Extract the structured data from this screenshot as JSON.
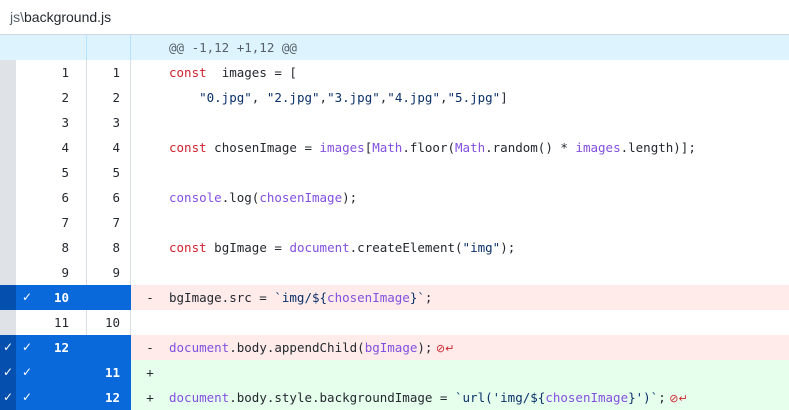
{
  "file": {
    "prefix": "js\\",
    "name": "background.js"
  },
  "hunk": "@@ -1,12 +1,12 @@",
  "lines": [
    {
      "old": "1",
      "new": "1",
      "sign": "",
      "type": "ctx",
      "sel_old": false,
      "sel_new": false,
      "check_gutter": false,
      "code": [
        [
          "kw",
          "const"
        ],
        [
          "",
          "  images = ["
        ]
      ]
    },
    {
      "old": "2",
      "new": "2",
      "sign": "",
      "type": "ctx",
      "sel_old": false,
      "sel_new": false,
      "check_gutter": false,
      "code": [
        [
          "",
          "    "
        ],
        [
          "str",
          "\"0.jpg\""
        ],
        [
          "",
          ", "
        ],
        [
          "str",
          "\"2.jpg\""
        ],
        [
          "",
          ","
        ],
        [
          "str",
          "\"3.jpg\""
        ],
        [
          "",
          ","
        ],
        [
          "str",
          "\"4.jpg\""
        ],
        [
          "",
          ","
        ],
        [
          "str",
          "\"5.jpg\""
        ],
        [
          "",
          "]"
        ]
      ]
    },
    {
      "old": "3",
      "new": "3",
      "sign": "",
      "type": "ctx",
      "sel_old": false,
      "sel_new": false,
      "check_gutter": false,
      "code": []
    },
    {
      "old": "4",
      "new": "4",
      "sign": "",
      "type": "ctx",
      "sel_old": false,
      "sel_new": false,
      "check_gutter": false,
      "code": [
        [
          "kw",
          "const"
        ],
        [
          "",
          " chosenImage = "
        ],
        [
          "fn",
          "images"
        ],
        [
          "",
          "["
        ],
        [
          "fn",
          "Math"
        ],
        [
          "",
          ".floor("
        ],
        [
          "fn",
          "Math"
        ],
        [
          "",
          ".random() * "
        ],
        [
          "fn",
          "images"
        ],
        [
          "",
          ".length)];"
        ]
      ]
    },
    {
      "old": "5",
      "new": "5",
      "sign": "",
      "type": "ctx",
      "sel_old": false,
      "sel_new": false,
      "check_gutter": false,
      "code": []
    },
    {
      "old": "6",
      "new": "6",
      "sign": "",
      "type": "ctx",
      "sel_old": false,
      "sel_new": false,
      "check_gutter": false,
      "code": [
        [
          "fn",
          "console"
        ],
        [
          "",
          ".log("
        ],
        [
          "fn",
          "chosenImage"
        ],
        [
          "",
          ");"
        ]
      ]
    },
    {
      "old": "7",
      "new": "7",
      "sign": "",
      "type": "ctx",
      "sel_old": false,
      "sel_new": false,
      "check_gutter": false,
      "code": []
    },
    {
      "old": "8",
      "new": "8",
      "sign": "",
      "type": "ctx",
      "sel_old": false,
      "sel_new": false,
      "check_gutter": false,
      "code": [
        [
          "kw",
          "const"
        ],
        [
          "",
          " bgImage = "
        ],
        [
          "fn",
          "document"
        ],
        [
          "",
          ".createElement("
        ],
        [
          "str",
          "\"img\""
        ],
        [
          "",
          ");"
        ]
      ]
    },
    {
      "old": "9",
      "new": "9",
      "sign": "",
      "type": "ctx",
      "sel_old": false,
      "sel_new": false,
      "check_gutter": false,
      "code": []
    },
    {
      "old": "10",
      "new": "",
      "sign": "-",
      "type": "del",
      "sel_old": true,
      "sel_new": true,
      "check_gutter": false,
      "code": [
        [
          "",
          "bgImage.src = "
        ],
        [
          "str",
          "`img/${"
        ],
        [
          "fn",
          "chosenImage"
        ],
        [
          "str",
          "}`"
        ],
        [
          "",
          ";"
        ]
      ]
    },
    {
      "old": "11",
      "new": "10",
      "sign": "",
      "type": "ctx",
      "sel_old": false,
      "sel_new": false,
      "check_gutter": false,
      "code": []
    },
    {
      "old": "12",
      "new": "",
      "sign": "-",
      "type": "del",
      "sel_old": true,
      "sel_new": true,
      "check_gutter": true,
      "code": [
        [
          "fn",
          "document"
        ],
        [
          "",
          ".body.appendChild("
        ],
        [
          "fn",
          "bgImage"
        ],
        [
          "",
          ");"
        ],
        [
          "nil",
          " ⊘↵"
        ]
      ]
    },
    {
      "old": "",
      "new": "11",
      "sign": "+",
      "type": "add",
      "sel_old": true,
      "sel_new": true,
      "check_gutter": true,
      "code": []
    },
    {
      "old": "",
      "new": "12",
      "sign": "+",
      "type": "add",
      "sel_old": true,
      "sel_new": true,
      "check_gutter": true,
      "code": [
        [
          "fn",
          "document"
        ],
        [
          "",
          ".body.style.backgroundImage = "
        ],
        [
          "str",
          "`url('img/${"
        ],
        [
          "fn",
          "chosenImage"
        ],
        [
          "str",
          "}')`"
        ],
        [
          "",
          ";"
        ],
        [
          "nil",
          " ⊘↵"
        ]
      ]
    }
  ]
}
